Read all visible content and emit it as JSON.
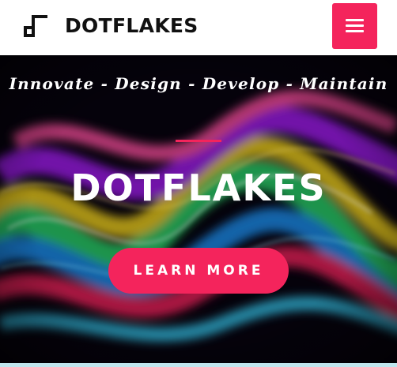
{
  "header": {
    "brand": "DOTFLAKES",
    "menu_icon": "hamburger-menu-icon",
    "logo_icon": "dotflakes-logo-icon",
    "accent_color": "#f4245c"
  },
  "hero": {
    "tagline": "Innovate - Design - Develop - Maintain",
    "title": "DOTFLAKES",
    "cta_label": "LEARN MORE",
    "background": "abstract colorful smoke waves on black"
  }
}
